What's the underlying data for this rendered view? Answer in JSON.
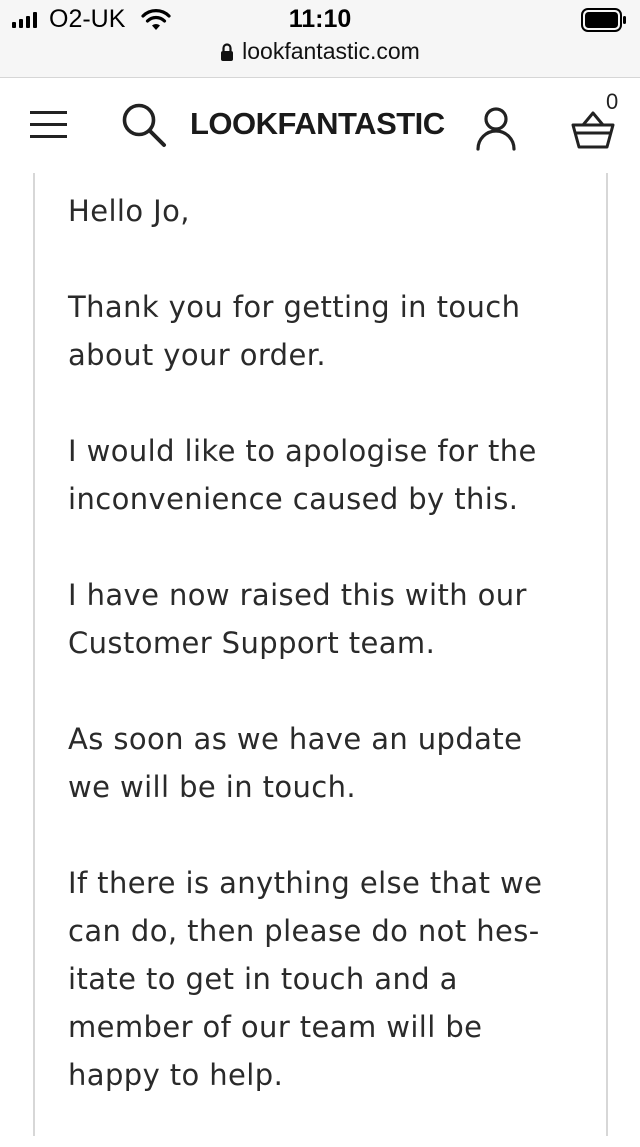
{
  "status_bar": {
    "carrier": "O2-UK",
    "time": "11:10",
    "icons": [
      "signal-icon",
      "wifi-icon",
      "battery-icon"
    ]
  },
  "url_bar": {
    "lock_icon": "lock-icon",
    "url": "lookfantastic.com"
  },
  "header": {
    "menu_icon": "hamburger-menu-icon",
    "search_icon": "search-icon",
    "logo": "LOOKFANTASTIC",
    "account_icon": "account-icon",
    "basket_icon": "basket-icon",
    "basket_count": "0"
  },
  "message": {
    "greeting": "Hello Jo,",
    "paragraphs": [
      "Thank you for getting in touch\nabout your order.",
      "I would like to apologise for the\ninconvenience caused by this.",
      "I have now raised this with our\nCustomer Support team.",
      "As soon as we have an update\nwe will be in touch.",
      "If there is anything else that we\ncan do, then please do not hes-\nitate to get in touch and a\nmember of our team will be\nhappy to help."
    ]
  },
  "colors": {
    "status_bg": "#f6f6f6",
    "panel_border": "#d7d7d7",
    "text": "#2a2a2a"
  }
}
